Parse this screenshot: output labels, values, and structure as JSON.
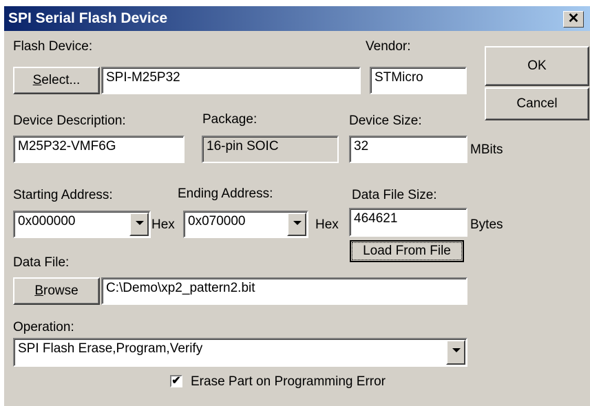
{
  "window": {
    "title": "SPI Serial Flash Device",
    "close_label": "✕"
  },
  "flash_device": {
    "label": "Flash Device:",
    "select_button_u": "S",
    "select_button_rest": "elect...",
    "value": "SPI-M25P32"
  },
  "vendor": {
    "label": "Vendor:",
    "value": "STMicro"
  },
  "ok_label": "OK",
  "cancel_label": "Cancel",
  "device_description": {
    "label": "Device Description:",
    "value": "M25P32-VMF6G"
  },
  "package": {
    "label": "Package:",
    "value": "16-pin SOIC"
  },
  "device_size": {
    "label": "Device Size:",
    "value": "32",
    "unit": "MBits"
  },
  "starting_address": {
    "label": "Starting Address:",
    "value": "0x000000",
    "suffix": "Hex"
  },
  "ending_address": {
    "label": "Ending Address:",
    "value": "0x070000",
    "suffix": "Hex"
  },
  "data_file_size": {
    "label": "Data File Size:",
    "value": "464621",
    "unit": "Bytes"
  },
  "load_from_file_label": "Load From File",
  "data_file": {
    "label": "Data File:",
    "browse_u": "B",
    "browse_rest": "rowse",
    "value": "C:\\Demo\\xp2_pattern2.bit"
  },
  "operation": {
    "label": "Operation:",
    "value": "SPI Flash Erase,Program,Verify"
  },
  "erase_checkbox": {
    "label": "Erase Part on Programming Error",
    "checked": true,
    "mark": "✔"
  }
}
